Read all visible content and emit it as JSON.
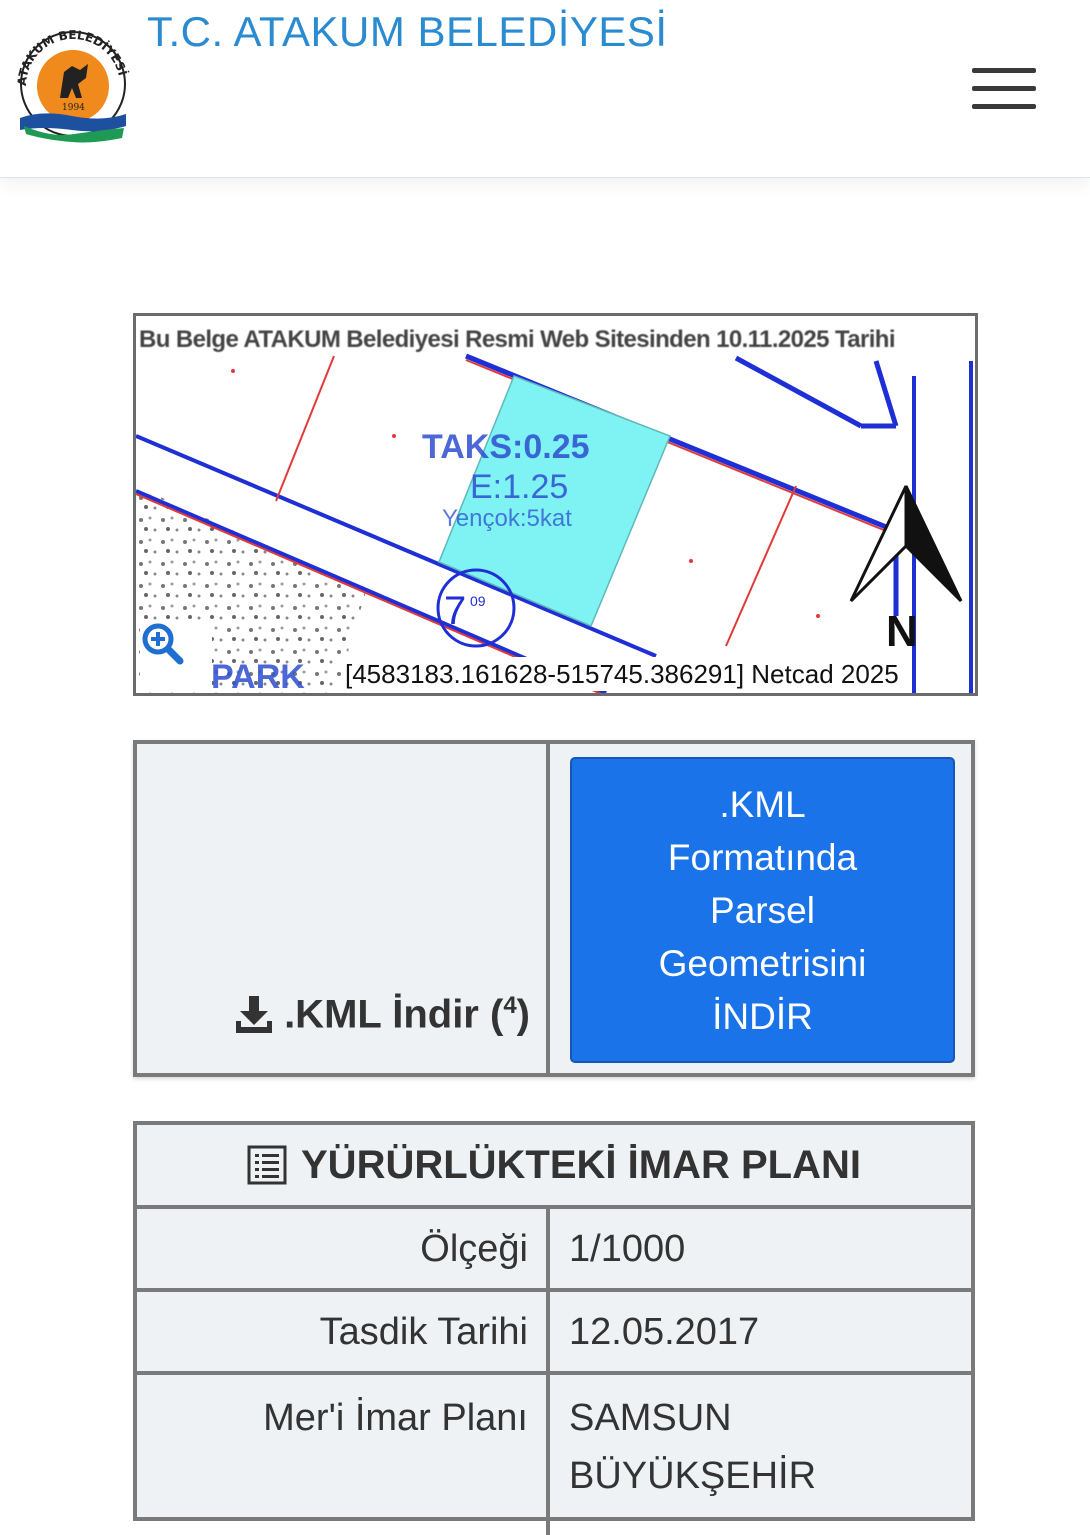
{
  "header": {
    "title": "T.C. ATAKUM BELEDİYESİ",
    "logo": {
      "top_text": "ATAKUM BELEDİYESİ",
      "year": "1994"
    },
    "menu_icon": "hamburger-icon"
  },
  "map": {
    "watermark": "Bu Belge ATAKUM Belediyesi Resmi Web Sitesinden 10.11.2025 Tarihi",
    "parcel_labels": {
      "taks": "TAKS:0.25",
      "emsal": "E:1.25",
      "height": "Yençok:5kat"
    },
    "block_number": "7",
    "park_label": "PARK",
    "north_label": "N",
    "coords": "[4583183.161628-515745.386291] Netcad 2025",
    "zoom_icon": "zoom-in-icon",
    "colors": {
      "parcel_fill": "#7ff3f3",
      "road_blue": "#1f2fd6",
      "boundary_red": "#e23a3a"
    }
  },
  "kml": {
    "link_label": ".KML İndir (",
    "link_sup": "4",
    "link_close": ")",
    "download_icon": "download-icon",
    "button_lines": [
      ".KML",
      "Formatında",
      "Parsel",
      "Geometrisini",
      "İNDİR"
    ],
    "button_color": "#1a73e8"
  },
  "imar": {
    "heading": "YÜRÜRLÜKTEKİ İMAR PLANI",
    "heading_icon": "list-icon",
    "rows": [
      {
        "label": "Ölçeği",
        "value_lines": [
          "1/1000"
        ]
      },
      {
        "label": "Tasdik Tarihi",
        "value_lines": [
          "12.05.2017"
        ]
      },
      {
        "label": "Mer'i İmar Planı",
        "value_lines": [
          "SAMSUN",
          "BÜYÜKŞEHİR"
        ]
      }
    ]
  }
}
